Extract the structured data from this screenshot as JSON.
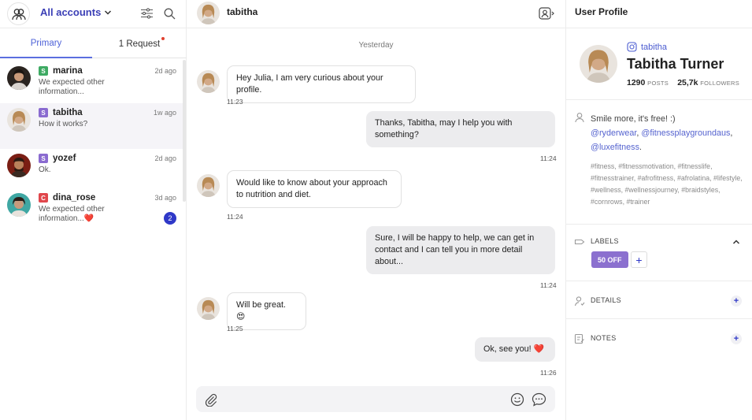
{
  "left": {
    "account_selector": "All accounts",
    "tabs": [
      {
        "label": "Primary"
      },
      {
        "label": "1 Request"
      }
    ],
    "conversations": [
      {
        "platform": "S",
        "platform_color": "#3eaa63",
        "name": "marina",
        "time": "2d ago",
        "message": "We expected other information...",
        "unread": ""
      },
      {
        "platform": "S",
        "platform_color": "#8a6bd0",
        "name": "tabitha",
        "time": "1w ago",
        "message": "How it works?",
        "unread": ""
      },
      {
        "platform": "S",
        "platform_color": "#8a6bd0",
        "name": "yozef",
        "time": "2d ago",
        "message": "Ok.",
        "unread": ""
      },
      {
        "platform": "C",
        "platform_color": "#e0474c",
        "name": "dina_rose",
        "time": "3d ago",
        "message": "We expected other information...❤️",
        "unread": "2"
      }
    ]
  },
  "chat": {
    "title": "tabitha",
    "day_separator": "Yesterday",
    "messages": [
      {
        "direction": "in",
        "text": "Hey Julia, I am very curious about your profile.",
        "time": "11:23"
      },
      {
        "direction": "out",
        "text": "Thanks, Tabitha, may I help you with something?",
        "time": "11:24"
      },
      {
        "direction": "in",
        "text": "Would like to know about your approach to nutrition and diet.",
        "time": "11:24"
      },
      {
        "direction": "out",
        "text": "Sure, I will be happy to help, we can get in contact and I can tell you in more detail about...",
        "time": "11:24"
      },
      {
        "direction": "in",
        "text": "Will be great. 😍",
        "time": "11:25"
      },
      {
        "direction": "out",
        "text": "Ok, see you!  ❤️",
        "time": "11:26"
      }
    ],
    "composer_placeholder": ""
  },
  "profile": {
    "panel_title": "User Profile",
    "handle": "tabitha",
    "full_name": "Tabitha Turner",
    "posts_count": "1290",
    "posts_label": "POSTS",
    "followers_count": "25,7k",
    "followers_label": "FOLLOWERS",
    "bio_text": "Smile more, it's free! :)",
    "bio_links": [
      "@ryderwear",
      "@fitnessplaygroundaus",
      "@luxefitness"
    ],
    "hashtags": "#fitness, #fitnessmotivation, #fitnesslife, #fitnesstrainer, #afrofitness, #afrolatina, #lifestyle, #wellness, #wellnessjourney, #braidstyles, #cornrows, #trainer",
    "labels_title": "LABELS",
    "label_chip": "50 OFF",
    "details_title": "DETAILS",
    "notes_title": "NOTES"
  },
  "colors": {
    "accent": "#3b3fb6",
    "tab_active": "#4f63d8",
    "chip": "#8b70cf",
    "badge": "#2f38c8"
  }
}
